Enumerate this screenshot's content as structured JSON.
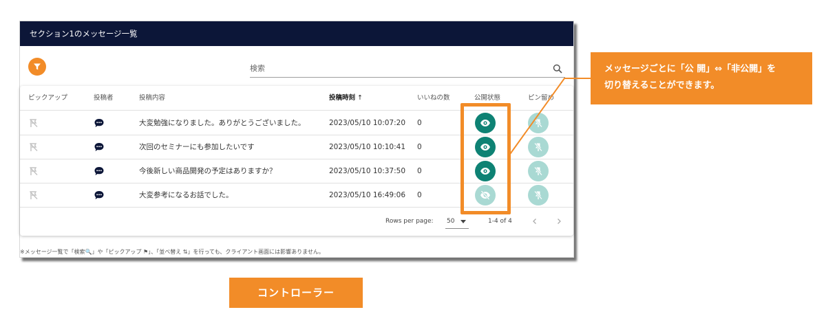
{
  "window": {
    "title": "セクション1のメッセージ一覧"
  },
  "search": {
    "placeholder": "検索"
  },
  "table": {
    "headers": {
      "pickup": "ピックアップ",
      "poster": "投稿者",
      "content": "投稿内容",
      "datetime": "投稿時刻",
      "likes": "いいねの数",
      "visibility": "公開状態",
      "pin": "ピン留め"
    },
    "rows": [
      {
        "content": "大変勉強になりました。ありがとうございました。",
        "datetime": "2023/05/10 10:07:20",
        "likes": "0",
        "visibility": "public"
      },
      {
        "content": "次回のセミナーにも参加したいです",
        "datetime": "2023/05/10 10:10:41",
        "likes": "0",
        "visibility": "public"
      },
      {
        "content": "今後新しい商品開発の予定はありますか？",
        "datetime": "2023/05/10 10:37:50",
        "likes": "0",
        "visibility": "public"
      },
      {
        "content": "大変参考になるお話でした。",
        "datetime": "2023/05/10 16:49:06",
        "likes": "0",
        "visibility": "private"
      }
    ]
  },
  "pagination": {
    "rows_per_page_label": "Rows per page:",
    "rows_per_page": "50",
    "range": "1-4 of 4"
  },
  "note": "※メッセージ一覧で「検索🔍」や「ピックアップ ⚑」、「並べ替え ⇅」を行っても、クライアント画面には影響ありません。",
  "callout": {
    "line1": "メッセージごとに「公 開」⇔「非公開」を",
    "line2": "切り替えることができます。"
  },
  "badge": "コントローラー",
  "colors": {
    "titlebar": "#0c1638",
    "accent_orange": "#f28c28",
    "public_teal": "#0e8274",
    "disabled_teal": "#a9d9d3"
  },
  "icons": {
    "pickup": "flag-off-icon",
    "poster": "chat-bubble-icon",
    "visibility_public": "eye-icon",
    "visibility_private": "eye-off-icon",
    "pin": "pin-off-icon",
    "filter": "filter-icon",
    "search": "search-icon"
  }
}
